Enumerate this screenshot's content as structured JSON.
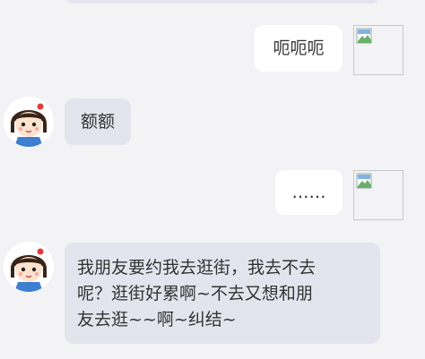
{
  "chat": {
    "messages": [
      {
        "side": "right",
        "text": "呃呃呃"
      },
      {
        "side": "left",
        "text": "额额"
      },
      {
        "side": "right",
        "text": "……"
      },
      {
        "side": "left",
        "lines": [
          "我朋友要约我去逛街，我去不去",
          "呢？逛街好累啊~不去又想和朋",
          "友去逛~~啊~纠结~"
        ]
      }
    ]
  },
  "colors": {
    "background": "#f3f3f5",
    "left_bubble": "#e4e4ef",
    "right_bubble": "#ffffff"
  },
  "icons": {
    "left_avatar": "girl-avatar-icon",
    "right_avatar": "broken-image-icon"
  }
}
